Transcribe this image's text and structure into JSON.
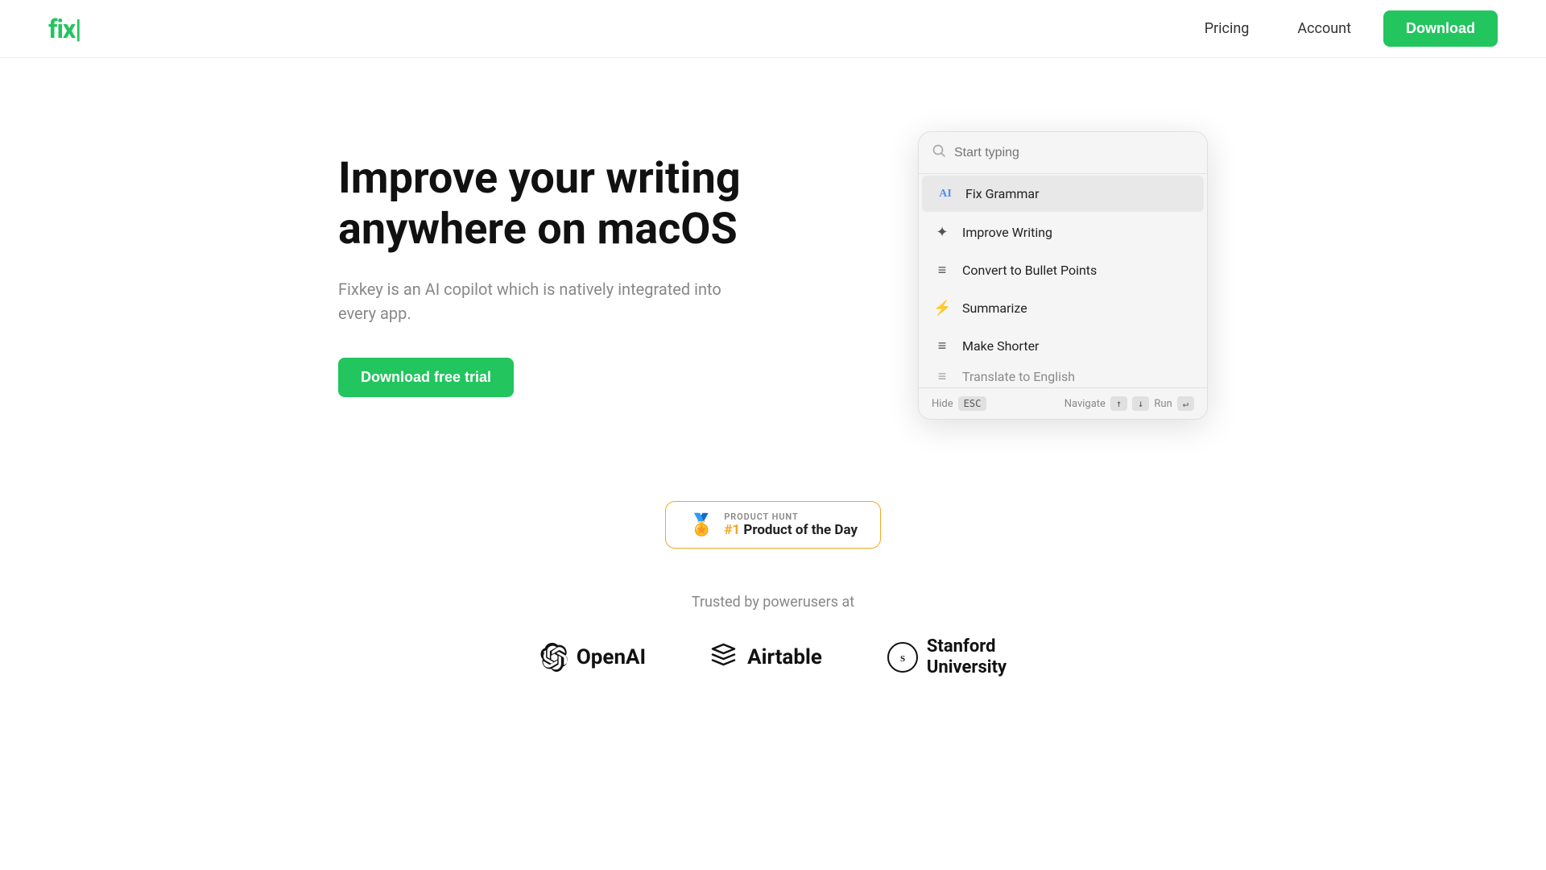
{
  "header": {
    "logo_text": "fix",
    "logo_cursor": "|",
    "nav_pricing": "Pricing",
    "nav_account": "Account",
    "nav_download": "Download"
  },
  "hero": {
    "title": "Improve your writing anywhere on macOS",
    "subtitle": "Fixkey is an AI copilot which is natively integrated into every app.",
    "cta_label": "Download free trial"
  },
  "popup": {
    "search_placeholder": "Start typing",
    "items": [
      {
        "id": "fix-grammar",
        "label": "Fix Grammar",
        "icon": "AI",
        "active": true
      },
      {
        "id": "improve-writing",
        "label": "Improve Writing",
        "icon": "✦",
        "active": false
      },
      {
        "id": "convert-bullets",
        "label": "Convert to Bullet Points",
        "icon": "≡",
        "active": false
      },
      {
        "id": "summarize",
        "label": "Summarize",
        "icon": "⚡",
        "active": false
      },
      {
        "id": "make-shorter",
        "label": "Make Shorter",
        "icon": "≡",
        "active": false
      },
      {
        "id": "translate-english",
        "label": "Translate to English",
        "icon": "≡",
        "active": false
      }
    ],
    "footer": {
      "hide_label": "Hide",
      "hide_key": "ESC",
      "navigate_label": "Navigate",
      "navigate_up": "↑",
      "navigate_down": "↓",
      "run_label": "Run",
      "run_key": "↵"
    }
  },
  "social_proof": {
    "ph_label": "PRODUCT HUNT",
    "ph_title": "#1 Product of the Day",
    "trusted_label": "Trusted by powerusers at"
  },
  "brands": [
    {
      "name": "OpenAI",
      "icon": "openai"
    },
    {
      "name": "Airtable",
      "icon": "airtable"
    },
    {
      "name": "Stanford\nUniversity",
      "icon": "stanford"
    }
  ]
}
